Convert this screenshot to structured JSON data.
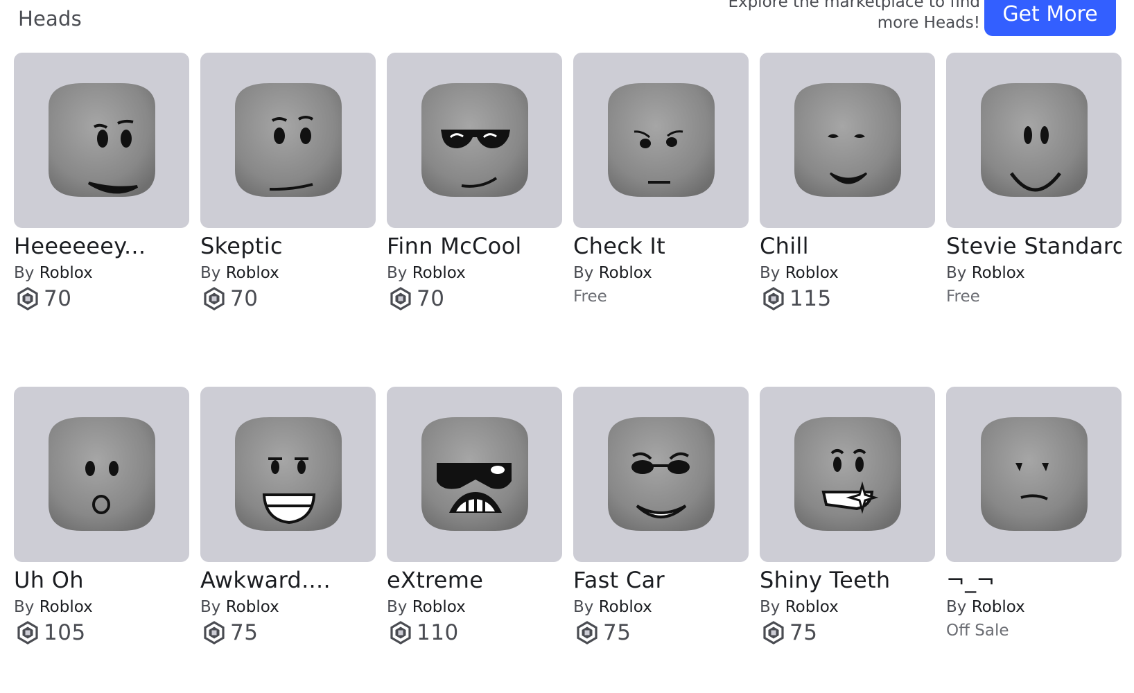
{
  "section": {
    "title": "Heads",
    "promo_text": "Explore the marketplace to find more Heads!",
    "get_more_label": "Get More"
  },
  "colors": {
    "accent": "#335fff",
    "thumb_bg": "#cdcdd5",
    "head": "#8d8d8d"
  },
  "items": [
    {
      "name": "Heeeeeey...",
      "by": "By",
      "creator": "Roblox",
      "price": "70",
      "status": "",
      "face": "smile-smirk"
    },
    {
      "name": "Skeptic",
      "by": "By",
      "creator": "Roblox",
      "price": "70",
      "status": "",
      "face": "skeptic"
    },
    {
      "name": "Finn McCool",
      "by": "By",
      "creator": "Roblox",
      "price": "70",
      "status": "",
      "face": "sunglasses"
    },
    {
      "name": "Check It",
      "by": "By",
      "creator": "Roblox",
      "price": "",
      "status": "Free",
      "face": "check-it"
    },
    {
      "name": "Chill",
      "by": "By",
      "creator": "Roblox",
      "price": "115",
      "status": "",
      "face": "chill"
    },
    {
      "name": "Stevie Standard",
      "by": "By",
      "creator": "Roblox",
      "price": "",
      "status": "Free",
      "face": "standard"
    },
    {
      "name": "Uh Oh",
      "by": "By",
      "creator": "Roblox",
      "price": "105",
      "status": "",
      "face": "uh-oh"
    },
    {
      "name": "Awkward....",
      "by": "By",
      "creator": "Roblox",
      "price": "75",
      "status": "",
      "face": "awkward"
    },
    {
      "name": "eXtreme",
      "by": "By",
      "creator": "Roblox",
      "price": "110",
      "status": "",
      "face": "extreme"
    },
    {
      "name": "Fast Car",
      "by": "By",
      "creator": "Roblox",
      "price": "75",
      "status": "",
      "face": "fast-car"
    },
    {
      "name": "Shiny Teeth",
      "by": "By",
      "creator": "Roblox",
      "price": "75",
      "status": "",
      "face": "shiny-teeth"
    },
    {
      "name": "¬_¬",
      "by": "By",
      "creator": "Roblox",
      "price": "",
      "status": "Off Sale",
      "face": "unamused"
    }
  ],
  "icons": {
    "currency": "robux-icon"
  }
}
